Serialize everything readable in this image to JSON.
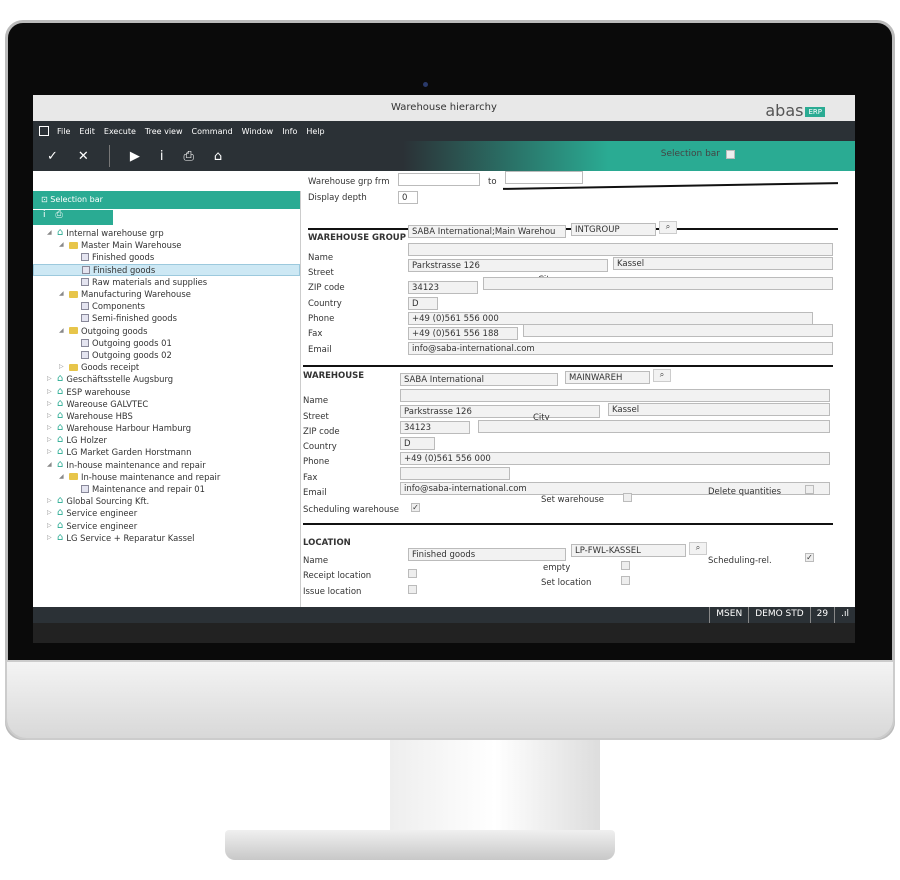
{
  "window": {
    "title": "Warehouse hierarchy",
    "logo": "abas",
    "logo_badge": "ERP"
  },
  "menu": [
    "File",
    "Edit",
    "Execute",
    "Tree view",
    "Command",
    "Window",
    "Info",
    "Help"
  ],
  "toolbar": {
    "icons": [
      "check-icon",
      "close-icon",
      "play-icon",
      "info-icon",
      "print-icon",
      "home-icon"
    ],
    "selection_bar_label": "Selection bar"
  },
  "left": {
    "header": "Selection bar",
    "tree": [
      {
        "label": "Internal warehouse grp",
        "level": 0,
        "icon": "house",
        "exp": "open"
      },
      {
        "label": "Master Main Warehouse",
        "level": 1,
        "icon": "folder",
        "exp": "open"
      },
      {
        "label": "Finished goods",
        "level": 2,
        "icon": "doc",
        "exp": ""
      },
      {
        "label": "Finished goods",
        "level": 2,
        "icon": "doc",
        "exp": "",
        "selected": true
      },
      {
        "label": "Raw materials and supplies",
        "level": 2,
        "icon": "doc",
        "exp": ""
      },
      {
        "label": "Manufacturing Warehouse",
        "level": 1,
        "icon": "folder",
        "exp": "open"
      },
      {
        "label": "Components",
        "level": 2,
        "icon": "doc",
        "exp": ""
      },
      {
        "label": "Semi-finished goods",
        "level": 2,
        "icon": "doc",
        "exp": ""
      },
      {
        "label": "Outgoing goods",
        "level": 1,
        "icon": "folder",
        "exp": "open"
      },
      {
        "label": "Outgoing goods 01",
        "level": 2,
        "icon": "doc",
        "exp": ""
      },
      {
        "label": "Outgoing goods 02",
        "level": 2,
        "icon": "doc",
        "exp": ""
      },
      {
        "label": "Goods receipt",
        "level": 1,
        "icon": "folder",
        "exp": "closed"
      },
      {
        "label": "Geschäftsstelle  Augsburg",
        "level": 0,
        "icon": "house",
        "exp": "closed"
      },
      {
        "label": "ESP warehouse",
        "level": 0,
        "icon": "house",
        "exp": "closed"
      },
      {
        "label": "Wareouse GALVTEC",
        "level": 0,
        "icon": "house",
        "exp": "closed"
      },
      {
        "label": "Warehouse HBS",
        "level": 0,
        "icon": "house",
        "exp": "closed"
      },
      {
        "label": "Warehouse Harbour Hamburg",
        "level": 0,
        "icon": "house",
        "exp": "closed"
      },
      {
        "label": "LG Holzer",
        "level": 0,
        "icon": "house",
        "exp": "closed"
      },
      {
        "label": "LG  Market Garden Horstmann",
        "level": 0,
        "icon": "house",
        "exp": "closed"
      },
      {
        "label": "In-house maintenance and repair",
        "level": 0,
        "icon": "house",
        "exp": "open"
      },
      {
        "label": "In-house maintenance and repair",
        "level": 1,
        "icon": "folder",
        "exp": "open"
      },
      {
        "label": "Maintenance and repair 01",
        "level": 2,
        "icon": "doc",
        "exp": ""
      },
      {
        "label": "Global Sourcing Kft.",
        "level": 0,
        "icon": "house",
        "exp": "closed"
      },
      {
        "label": "Service engineer",
        "level": 0,
        "icon": "house",
        "exp": "closed"
      },
      {
        "label": "Service engineer",
        "level": 0,
        "icon": "house",
        "exp": "closed"
      },
      {
        "label": "LG Service + Reparatur Kassel",
        "level": 0,
        "icon": "house",
        "exp": "closed"
      }
    ]
  },
  "filter": {
    "grp_from_label": "Warehouse grp frm",
    "to_label": "to",
    "grp_from": "",
    "grp_to": "",
    "depth_label": "Display depth",
    "depth": "0"
  },
  "labels": {
    "name": "Name",
    "street": "Street",
    "zip": "ZIP code",
    "country": "Country",
    "phone": "Phone",
    "fax": "Fax",
    "email": "Email",
    "city": "City"
  },
  "group": {
    "title": "WAREHOUSE GROUP",
    "name": "SABA International;Main Warehou",
    "code": "INTGROUP",
    "street": "Parkstrasse 126",
    "city": "Kassel",
    "zip": "34123",
    "country": "D",
    "phone": "+49 (0)561 556 000",
    "fax": "+49 (0)561 556 188",
    "email": "info@saba-international.com"
  },
  "warehouse": {
    "title": "WAREHOUSE",
    "name": "SABA International",
    "code": "MAINWAREH",
    "street": "Parkstrasse 126",
    "city": "Kassel",
    "zip": "34123",
    "country": "D",
    "phone": "+49 (0)561 556 000",
    "fax": "",
    "email": "info@saba-international.com",
    "set_warehouse_label": "Set warehouse",
    "delete_quantities_label": "Delete quantities",
    "scheduling_label": "Scheduling warehouse",
    "scheduling": true
  },
  "location": {
    "title": "LOCATION",
    "name_label": "Name",
    "name": "Finished goods",
    "code": "LP-FWL-KASSEL",
    "scheduling_rel_label": "Scheduling-rel.",
    "scheduling_rel": true,
    "empty_label": "empty",
    "receipt_label": "Receipt location",
    "set_location_label": "Set location",
    "issue_label": "Issue location"
  },
  "status": [
    "MSEN",
    "DEMO STD",
    "29"
  ],
  "colors": {
    "accent": "#2aab93",
    "dark": "#2b3136"
  }
}
